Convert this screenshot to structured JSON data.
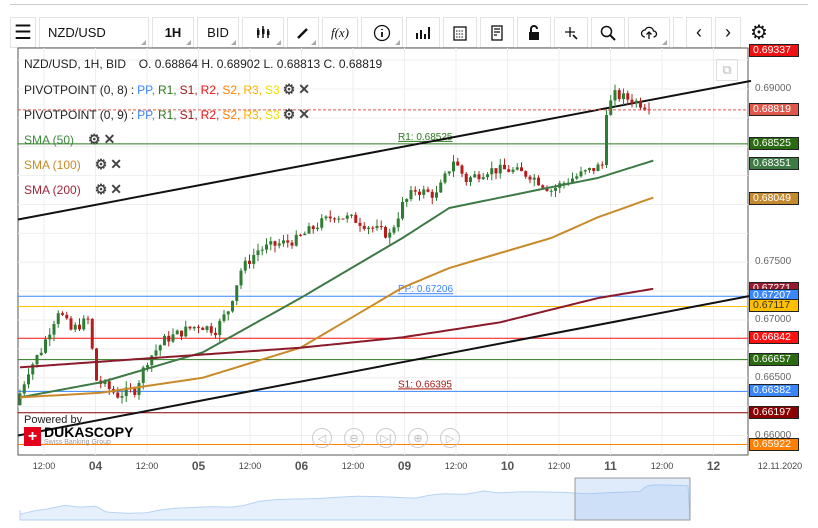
{
  "toolbar": {
    "symbol": "NZD/USD",
    "timeframe": "1H",
    "side": "BID"
  },
  "header": {
    "title": "NZD/USD, 1H, BID",
    "ohlc": "O. 0.68864 H. 0.68902 L. 0.68813 C. 0.68819"
  },
  "indicators": [
    {
      "name": "PIVOTPOINT (0, 8)",
      "sep": ":",
      "parts": [
        {
          "t": "PP",
          "c": "#3a86ff"
        },
        {
          "t": "R1",
          "c": "#2a7a1c"
        },
        {
          "t": "S1",
          "c": "#a31a1a"
        },
        {
          "t": "R2",
          "c": "#ee1111"
        },
        {
          "t": "S2",
          "c": "#ff8000"
        },
        {
          "t": "R3",
          "c": "#ffb300"
        },
        {
          "t": "S3",
          "c": "#f0e000"
        }
      ]
    },
    {
      "name": "PIVOTPOINT (0, 9)",
      "sep": ":",
      "parts": [
        {
          "t": "PP",
          "c": "#3a86ff"
        },
        {
          "t": "R1",
          "c": "#2a7a1c"
        },
        {
          "t": "S1",
          "c": "#a31a1a"
        },
        {
          "t": "R2",
          "c": "#ee1111"
        },
        {
          "t": "S2",
          "c": "#ff8000"
        },
        {
          "t": "R3",
          "c": "#ffb300"
        },
        {
          "t": "S3",
          "c": "#f0e000"
        }
      ]
    },
    {
      "name": "SMA (50)",
      "color": "#3d8a3d"
    },
    {
      "name": "SMA (100)",
      "color": "#c98a2a"
    },
    {
      "name": "SMA (200)",
      "color": "#a0263a"
    }
  ],
  "y_ticks": [
    "0.69000",
    "0.67500",
    "0.67000",
    "0.66500",
    "0.66000"
  ],
  "y_tick_values": [
    0.69,
    0.675,
    0.67,
    0.665,
    0.66
  ],
  "price_labels": [
    {
      "v": 0.69337,
      "text": "0.69337",
      "bg": "#ee1111"
    },
    {
      "v": 0.68819,
      "text": "0.68819",
      "bg": "#e0584a"
    },
    {
      "v": 0.68525,
      "text": "0.68525",
      "bg": "#2a6a10"
    },
    {
      "v": 0.68351,
      "text": "0.68351",
      "bg": "#3d7a45"
    },
    {
      "v": 0.68049,
      "text": "0.68049",
      "bg": "#c48a30"
    },
    {
      "v": 0.67271,
      "text": "0.67271",
      "bg": "#931c30"
    },
    {
      "v": 0.67207,
      "text": "0.67207",
      "bg": "#3a86ff"
    },
    {
      "v": 0.67117,
      "text": "0.67117",
      "bg": "#ffc000",
      "fg": "#333"
    },
    {
      "v": 0.66842,
      "text": "0.66842",
      "bg": "#ff1111"
    },
    {
      "v": 0.66657,
      "text": "0.66657",
      "bg": "#2a6a10"
    },
    {
      "v": 0.66382,
      "text": "0.66382",
      "bg": "#3a86ff"
    },
    {
      "v": 0.66197,
      "text": "0.66197",
      "bg": "#8b0000"
    },
    {
      "v": 0.65922,
      "text": "0.65922",
      "bg": "#ff8000"
    }
  ],
  "levels": [
    {
      "v": 0.68525,
      "c": "#2a7a1c",
      "label": "R1: 0.68525"
    },
    {
      "v": 0.67206,
      "c": "#3a86ff",
      "label": "PP: 0.67206"
    },
    {
      "v": 0.67117,
      "c": "#ffc000"
    },
    {
      "v": 0.66842,
      "c": "#ff1111"
    },
    {
      "v": 0.66657,
      "c": "#2a7a1c"
    },
    {
      "v": 0.66382,
      "c": "#3a86ff",
      "label": "S1: 0.66395",
      "lc": "#a31a1a"
    },
    {
      "v": 0.66197,
      "c": "#8b0000"
    },
    {
      "v": 0.65922,
      "c": "#ff8000"
    }
  ],
  "last_price": 0.68819,
  "price_path": [
    [
      0,
      0.66264
    ],
    [
      3,
      0.66567
    ],
    [
      6,
      0.6674
    ],
    [
      10,
      0.67087
    ],
    [
      13,
      0.66913
    ],
    [
      17,
      0.67
    ],
    [
      19,
      0.6648
    ],
    [
      24,
      0.66351
    ],
    [
      28,
      0.66394
    ],
    [
      31,
      0.66654
    ],
    [
      35,
      0.66827
    ],
    [
      40,
      0.66913
    ],
    [
      43,
      0.66957
    ],
    [
      47,
      0.66913
    ],
    [
      50,
      0.67087
    ],
    [
      53,
      0.67433
    ],
    [
      57,
      0.67606
    ],
    [
      61,
      0.67649
    ],
    [
      66,
      0.67693
    ],
    [
      71,
      0.67823
    ],
    [
      75,
      0.67909
    ],
    [
      80,
      0.67866
    ],
    [
      85,
      0.67779
    ],
    [
      88,
      0.67736
    ],
    [
      91,
      0.67996
    ],
    [
      94,
      0.68126
    ],
    [
      99,
      0.68082
    ],
    [
      103,
      0.68385
    ],
    [
      106,
      0.68212
    ],
    [
      111,
      0.68299
    ],
    [
      116,
      0.68299
    ],
    [
      121,
      0.68255
    ],
    [
      126,
      0.68126
    ],
    [
      130,
      0.68212
    ],
    [
      138,
      0.68342
    ],
    [
      139,
      0.68818
    ],
    [
      141,
      0.68948
    ],
    [
      145,
      0.68905
    ],
    [
      148,
      0.68861
    ]
  ],
  "sma50": [
    [
      0,
      0.6633
    ],
    [
      19,
      0.6646
    ],
    [
      43,
      0.6672
    ],
    [
      66,
      0.6719
    ],
    [
      78,
      0.6745
    ],
    [
      90,
      0.6771
    ],
    [
      101,
      0.6797
    ],
    [
      113,
      0.6806
    ],
    [
      125,
      0.6815
    ],
    [
      136,
      0.6823
    ],
    [
      149,
      0.6838
    ]
  ],
  "sma100": [
    [
      0,
      0.6633
    ],
    [
      19,
      0.6637
    ],
    [
      43,
      0.665
    ],
    [
      66,
      0.6676
    ],
    [
      78,
      0.6702
    ],
    [
      90,
      0.6728
    ],
    [
      101,
      0.6745
    ],
    [
      113,
      0.6758
    ],
    [
      125,
      0.6771
    ],
    [
      136,
      0.6789
    ],
    [
      149,
      0.6806
    ]
  ],
  "sma200": [
    [
      0,
      0.6659
    ],
    [
      31,
      0.6667
    ],
    [
      66,
      0.6676
    ],
    [
      90,
      0.6685
    ],
    [
      113,
      0.6698
    ],
    [
      136,
      0.6719
    ],
    [
      149,
      0.6727
    ]
  ],
  "trendlines": [
    [
      [
        0,
        0.6787
      ],
      [
        172,
        0.6907
      ]
    ],
    [
      [
        0,
        0.66
      ],
      [
        172,
        0.6721
      ]
    ]
  ],
  "x_labels": [
    {
      "t": "12:00"
    },
    {
      "t": "04",
      "day": true
    },
    {
      "t": "12:00"
    },
    {
      "t": "05",
      "day": true
    },
    {
      "t": "12:00"
    },
    {
      "t": "06",
      "day": true
    },
    {
      "t": "12:00"
    },
    {
      "t": "09",
      "day": true
    },
    {
      "t": "12:00"
    },
    {
      "t": "10",
      "day": true
    },
    {
      "t": "12:00"
    },
    {
      "t": "11",
      "day": true
    },
    {
      "t": "12:00"
    },
    {
      "t": "12",
      "day": true
    },
    {
      "t": "12.11.2020"
    }
  ],
  "branding": {
    "powered": "Powered by",
    "name": "DUKASCOPY",
    "sub": "Swiss Banking Group"
  },
  "nav": [
    "◁",
    "⊖",
    "▷|",
    "⊕",
    "▷"
  ]
}
